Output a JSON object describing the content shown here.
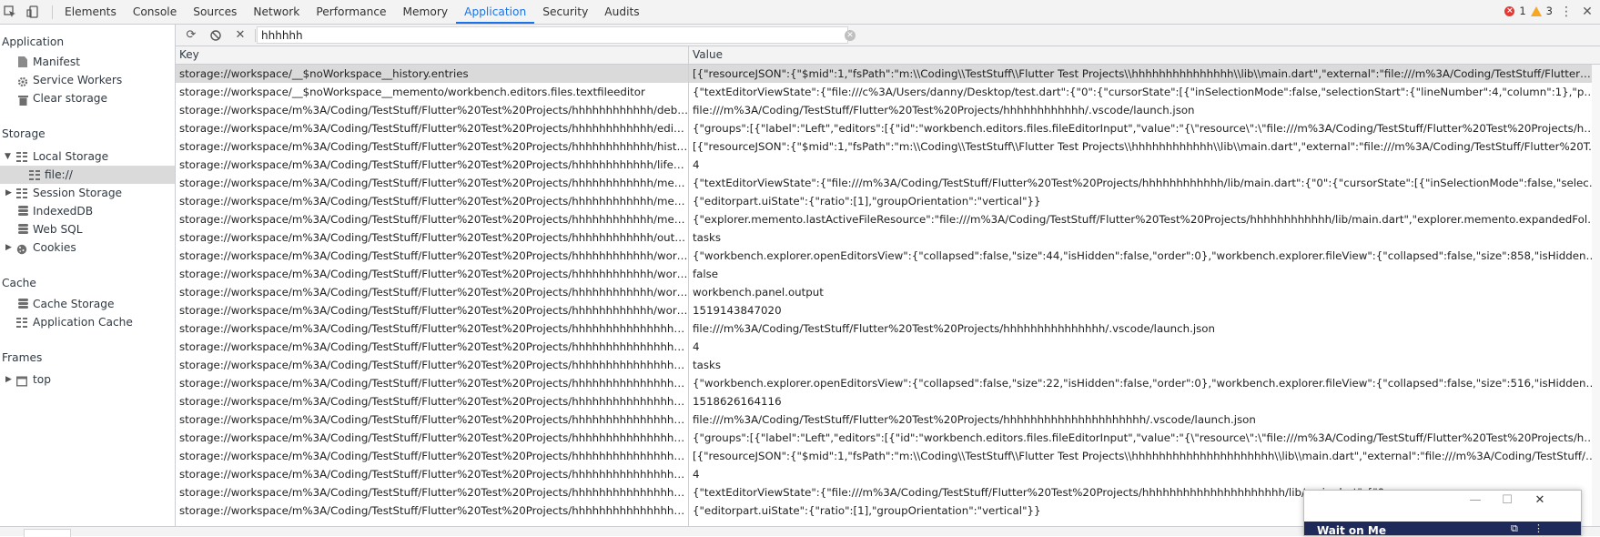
{
  "toolbar": {
    "tabs": [
      "Elements",
      "Console",
      "Sources",
      "Network",
      "Performance",
      "Memory",
      "Application",
      "Security",
      "Audits"
    ],
    "active_tab": "Application",
    "error_count": "1",
    "warning_count": "3",
    "colors": {
      "accent": "#1a73e8",
      "error": "#e53935",
      "warning": "#f5a623"
    }
  },
  "sidebar": {
    "application_header": "Application",
    "manifest": "Manifest",
    "service_workers": "Service Workers",
    "clear_storage": "Clear storage",
    "storage_header": "Storage",
    "local_storage": "Local Storage",
    "local_storage_origin": "file://",
    "session_storage": "Session Storage",
    "indexeddb": "IndexedDB",
    "web_sql": "Web SQL",
    "cookies": "Cookies",
    "cache_header": "Cache",
    "cache_storage": "Cache Storage",
    "application_cache": "Application Cache",
    "frames_header": "Frames",
    "frames_top": "top"
  },
  "filter": {
    "value": "hhhhhh"
  },
  "table": {
    "key_header": "Key",
    "value_header": "Value",
    "rows": [
      {
        "key": "storage://workspace/__$noWorkspace__history.entries",
        "value": "[{\"resourceJSON\":{\"$mid\":1,\"fsPath\":\"m:\\\\Coding\\\\TestStuff\\\\Flutter Test Projects\\\\hhhhhhhhhhhhhhh\\\\lib\\\\main.dart\",\"external\":\"file:///m%3A/Coding/TestStuff/Flutter%20Test%20Projec..."
      },
      {
        "key": "storage://workspace/__$noWorkspace__memento/workbench.editors.files.textfileeditor",
        "value": "{\"textEditorViewState\":{\"file:///c%3A/Users/danny/Desktop/test.dart\":{\"0\":{\"cursorState\":[{\"inSelectionMode\":false,\"selectionStart\":{\"lineNumber\":4,\"column\":1},\"position\":{\"lineNumber\":4,\"..."
      },
      {
        "key": "storage://workspace/m%3A/Coding/TestStuff/Flutter%20Test%20Projects/hhhhhhhhhhhh/debug.select...",
        "value": "file:///m%3A/Coding/TestStuff/Flutter%20Test%20Projects/hhhhhhhhhhhh/.vscode/launch.json"
      },
      {
        "key": "storage://workspace/m%3A/Coding/TestStuff/Flutter%20Test%20Projects/hhhhhhhhhhhh/editorstacks....",
        "value": "{\"groups\":[{\"label\":\"Left\",\"editors\":[{\"id\":\"workbench.editors.files.fileEditorInput\",\"value\":\"{\\\"resource\\\":\\\"file:///m%3A/Coding/TestStuff/Flutter%20Test%20Projects/hhhhhhhhhhhh/lib/mai..."
      },
      {
        "key": "storage://workspace/m%3A/Coding/TestStuff/Flutter%20Test%20Projects/hhhhhhhhhhhh/history.entries",
        "value": "[{\"resourceJSON\":{\"$mid\":1,\"fsPath\":\"m:\\\\Coding\\\\TestStuff\\\\Flutter Test Projects\\\\hhhhhhhhhhhh\\\\lib\\\\main.dart\",\"external\":\"file:///m%3A/Coding/TestStuff/Flutter%20Test%20Projects/h..."
      },
      {
        "key": "storage://workspace/m%3A/Coding/TestStuff/Flutter%20Test%20Projects/hhhhhhhhhhhh/lifecycle.lastsh...",
        "value": "4"
      },
      {
        "key": "storage://workspace/m%3A/Coding/TestStuff/Flutter%20Test%20Projects/hhhhhhhhhhhh/memento/wo...",
        "value": "{\"textEditorViewState\":{\"file:///m%3A/Coding/TestStuff/Flutter%20Test%20Projects/hhhhhhhhhhhh/lib/main.dart\":{\"0\":{\"cursorState\":[{\"inSelectionMode\":false,\"selectionStart\":{\"lineNumb..."
      },
      {
        "key": "storage://workspace/m%3A/Coding/TestStuff/Flutter%20Test%20Projects/hhhhhhhhhhhh/memento/wo...",
        "value": "{\"editorpart.uiState\":{\"ratio\":[1],\"groupOrientation\":\"vertical\"}}"
      },
      {
        "key": "storage://workspace/m%3A/Coding/TestStuff/Flutter%20Test%20Projects/hhhhhhhhhhhh/memento/wo...",
        "value": "{\"explorer.memento.lastActiveFileResource\":\"file:///m%3A/Coding/TestStuff/Flutter%20Test%20Projects/hhhhhhhhhhhh/lib/main.dart\",\"explorer.memento.expandedFolderResources\":[\"fil..."
      },
      {
        "key": "storage://workspace/m%3A/Coding/TestStuff/Flutter%20Test%20Projects/hhhhhhhhhhhh/output.active...",
        "value": "tasks"
      },
      {
        "key": "storage://workspace/m%3A/Coding/TestStuff/Flutter%20Test%20Projects/hhhhhhhhhhhh/workbench.e...",
        "value": "{\"workbench.explorer.openEditorsView\":{\"collapsed\":false,\"size\":44,\"isHidden\":false,\"order\":0},\"workbench.explorer.fileView\":{\"collapsed\":false,\"size\":858,\"isHidden\":false,\"order\":1},\"dartPa..."
      },
      {
        "key": "storage://workspace/m%3A/Coding/TestStuff/Flutter%20Test%20Projects/hhhhhhhhhhhh/workbench.p...",
        "value": "false"
      },
      {
        "key": "storage://workspace/m%3A/Coding/TestStuff/Flutter%20Test%20Projects/hhhhhhhhhhhh/workbench.p...",
        "value": "workbench.panel.output"
      },
      {
        "key": "storage://workspace/m%3A/Coding/TestStuff/Flutter%20Test%20Projects/hhhhhhhhhhhh/workspaceide...",
        "value": "1519143847020"
      },
      {
        "key": "storage://workspace/m%3A/Coding/TestStuff/Flutter%20Test%20Projects/hhhhhhhhhhhhhhh/debug.se...",
        "value": "file:///m%3A/Coding/TestStuff/Flutter%20Test%20Projects/hhhhhhhhhhhhhhh/.vscode/launch.json"
      },
      {
        "key": "storage://workspace/m%3A/Coding/TestStuff/Flutter%20Test%20Projects/hhhhhhhhhhhhhhh/lifecycle.la...",
        "value": "4"
      },
      {
        "key": "storage://workspace/m%3A/Coding/TestStuff/Flutter%20Test%20Projects/hhhhhhhhhhhhhhh/output.ac...",
        "value": "tasks"
      },
      {
        "key": "storage://workspace/m%3A/Coding/TestStuff/Flutter%20Test%20Projects/hhhhhhhhhhhhhhh/workbenc...",
        "value": "{\"workbench.explorer.openEditorsView\":{\"collapsed\":false,\"size\":22,\"isHidden\":false,\"order\":0},\"workbench.explorer.fileView\":{\"collapsed\":false,\"size\":516,\"isHidden\":false,\"order\":1},\"dartPa..."
      },
      {
        "key": "storage://workspace/m%3A/Coding/TestStuff/Flutter%20Test%20Projects/hhhhhhhhhhhhhhh/workspac...",
        "value": "1518626164116"
      },
      {
        "key": "storage://workspace/m%3A/Coding/TestStuff/Flutter%20Test%20Projects/hhhhhhhhhhhhhhhhhhhhh/de...",
        "value": "file:///m%3A/Coding/TestStuff/Flutter%20Test%20Projects/hhhhhhhhhhhhhhhhhhhhh/.vscode/launch.json"
      },
      {
        "key": "storage://workspace/m%3A/Coding/TestStuff/Flutter%20Test%20Projects/hhhhhhhhhhhhhhhhhhhhh/edi...",
        "value": "{\"groups\":[{\"label\":\"Left\",\"editors\":[{\"id\":\"workbench.editors.files.fileEditorInput\",\"value\":\"{\\\"resource\\\":\\\"file:///m%3A/Coding/TestStuff/Flutter%20Test%20Projects/hhhhhhhhhhhhhhhh..."
      },
      {
        "key": "storage://workspace/m%3A/Coding/TestStuff/Flutter%20Test%20Projects/hhhhhhhhhhhhhhhhhhhhh/his...",
        "value": "[{\"resourceJSON\":{\"$mid\":1,\"fsPath\":\"m:\\\\Coding\\\\TestStuff\\\\Flutter Test Projects\\\\hhhhhhhhhhhhhhhhhhhhh\\\\lib\\\\main.dart\",\"external\":\"file:///m%3A/Coding/TestStuff/Flutter%20..."
      },
      {
        "key": "storage://workspace/m%3A/Coding/TestStuff/Flutter%20Test%20Projects/hhhhhhhhhhhhhhhhhhhhh/life...",
        "value": "4"
      },
      {
        "key": "storage://workspace/m%3A/Coding/TestStuff/Flutter%20Test%20Projects/hhhhhhhhhhhhhhhhhhhhh/me...",
        "value": "{\"textEditorViewState\":{\"file:///m%3A/Coding/TestStuff/Flutter%20Test%20Projects/hhhhhhhhhhhhhhhhhhhhh/lib/main.dart\":{\"0"
      },
      {
        "key": "storage://workspace/m%3A/Coding/TestStuff/Flutter%20Test%20Projects/hhhhhhhhhhhhhhhhhhhhh/me...",
        "value": "{\"editorpart.uiState\":{\"ratio\":[1],\"groupOrientation\":\"vertical\"}}"
      }
    ]
  },
  "popup": {
    "title": "Wait on Me"
  }
}
